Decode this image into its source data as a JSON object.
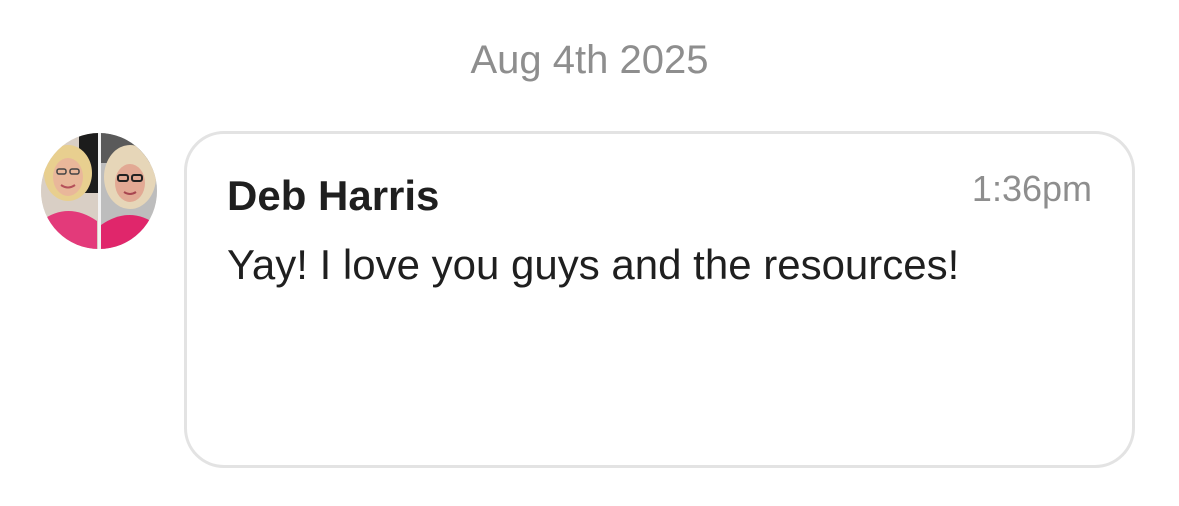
{
  "conversation": {
    "date_divider": "Aug 4th 2025",
    "messages": [
      {
        "sender": "Deb Harris",
        "time": "1:36pm",
        "text": "Yay! I love you guys and the resources!",
        "avatar_icon": "user-photo-avatar"
      }
    ]
  },
  "colors": {
    "background": "#ffffff",
    "muted_text": "#8e8e8e",
    "primary_text": "#1f1f1f",
    "bubble_border": "#e3e3e3"
  }
}
